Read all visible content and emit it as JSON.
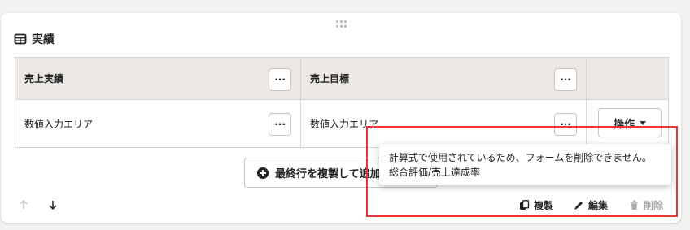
{
  "section": {
    "title": "実績",
    "icon": "table-icon"
  },
  "table": {
    "headers": [
      "売上実績",
      "売上目標",
      ""
    ],
    "rows": [
      {
        "cells": [
          "数値入力エリア",
          "数値入力エリア"
        ],
        "operation_label": "操作"
      }
    ],
    "more_label": "···"
  },
  "duplicate_last_row_label": "最終行を複製して追加",
  "tooltip": {
    "line1": "計算式で使用されているため、フォームを削除できません。",
    "line2": "総合評価/売上達成率"
  },
  "actions": {
    "copy_label": "複製",
    "edit_label": "編集",
    "delete_label": "削除"
  },
  "colors": {
    "highlight": "#e53935",
    "header_bg": "#ebe8e5",
    "disabled": "#aaaaaa"
  }
}
